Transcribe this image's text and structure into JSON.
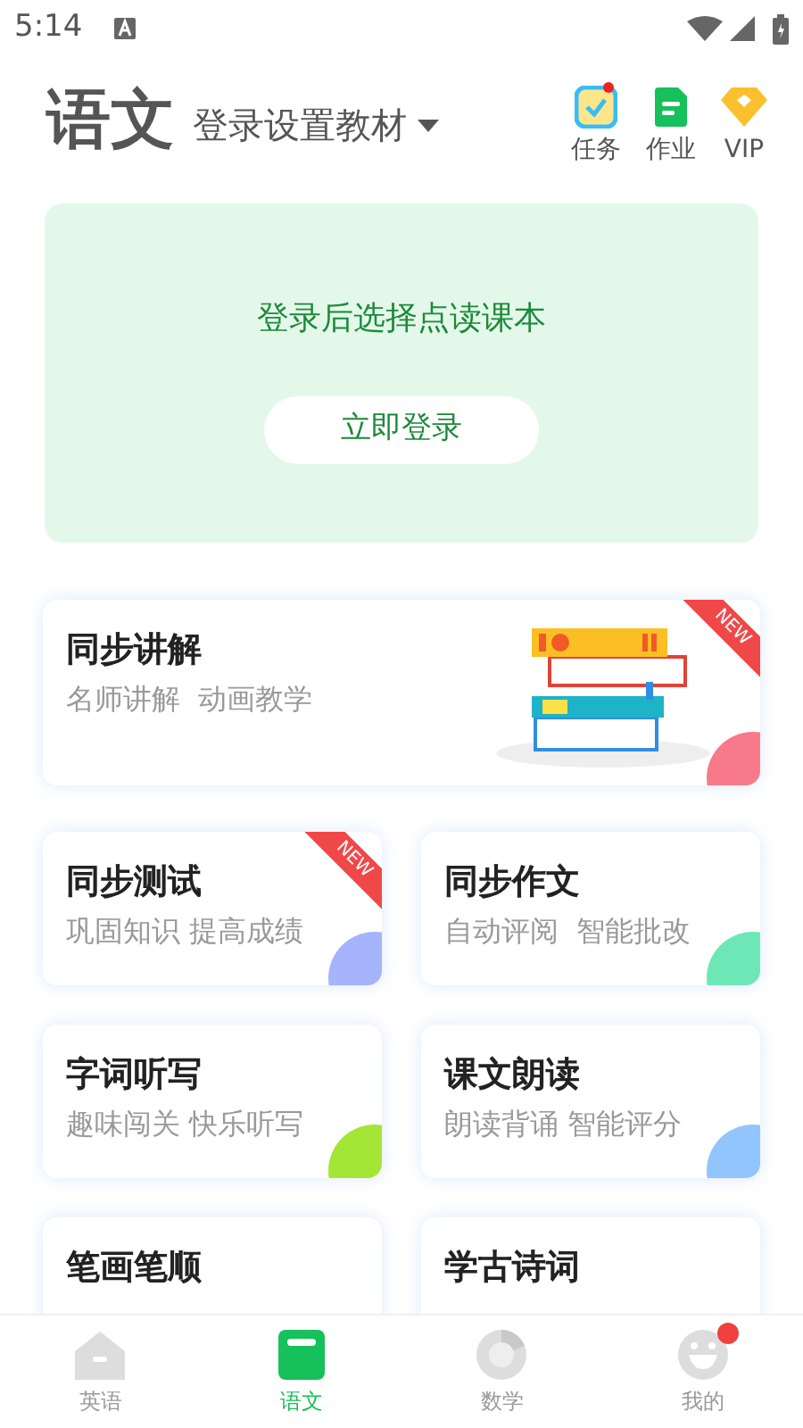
{
  "status_bar": {
    "time": "5:14"
  },
  "header": {
    "subject": "语文",
    "textbook_selector": "登录设置教材",
    "actions": [
      {
        "label": "任务",
        "kind": "task",
        "badge": true
      },
      {
        "label": "作业",
        "kind": "homework",
        "badge": false
      },
      {
        "label": "VIP",
        "kind": "vip",
        "badge": false
      }
    ]
  },
  "login_banner": {
    "message": "登录后选择点读课本",
    "button": "立即登录"
  },
  "featured": {
    "title": "同步讲解",
    "subtitle": "名师讲解  动画教学",
    "new_badge": "NEW",
    "color": "#f87a8a"
  },
  "features": [
    {
      "title": "同步测试",
      "subtitle": "巩固知识 提高成绩",
      "new_badge": "NEW",
      "color": "#a5b4fc"
    },
    {
      "title": "同步作文",
      "subtitle": "自动评阅  智能批改",
      "color": "#6ee7b7"
    },
    {
      "title": "字词听写",
      "subtitle": "趣味闯关 快乐听写",
      "color": "#a3e635"
    },
    {
      "title": "课文朗读",
      "subtitle": "朗读背诵 智能评分",
      "color": "#93c5fd"
    },
    {
      "title": "笔画笔顺"
    },
    {
      "title": "学古诗词"
    }
  ],
  "bottom_nav": [
    {
      "label": "英语",
      "kind": "english",
      "selected": false,
      "badge": false
    },
    {
      "label": "语文",
      "kind": "chinese",
      "selected": true,
      "badge": false
    },
    {
      "label": "数学",
      "kind": "math",
      "selected": false,
      "badge": false
    },
    {
      "label": "我的",
      "kind": "me",
      "selected": false,
      "badge": true
    }
  ]
}
